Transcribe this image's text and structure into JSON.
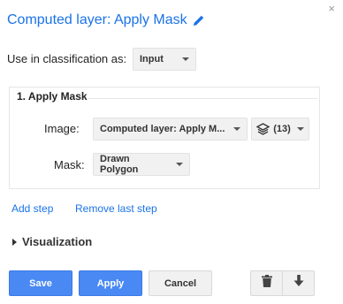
{
  "dialog": {
    "close_glyph": "×",
    "title": "Computed layer: Apply Mask"
  },
  "classification": {
    "label": "Use in classification as:",
    "selected": "Input"
  },
  "step": {
    "title": "1. Apply Mask",
    "image_label": "Image:",
    "image_value": "Computed layer: Apply M...",
    "layers_count": "(13)",
    "mask_label": "Mask:",
    "mask_value": "Drawn Polygon"
  },
  "links": {
    "add_step": "Add step",
    "remove_last_step": "Remove last step"
  },
  "visualization": {
    "label": "Visualization",
    "expanded": false
  },
  "buttons": {
    "save": "Save",
    "apply": "Apply",
    "cancel": "Cancel"
  },
  "icons": {
    "edit": "pencil-icon",
    "layers": "layers-icon",
    "delete": "trash-icon",
    "download": "download-icon",
    "close": "close-icon"
  },
  "colors": {
    "link": "#1a73e8",
    "primary_button": "#4a89f3"
  }
}
